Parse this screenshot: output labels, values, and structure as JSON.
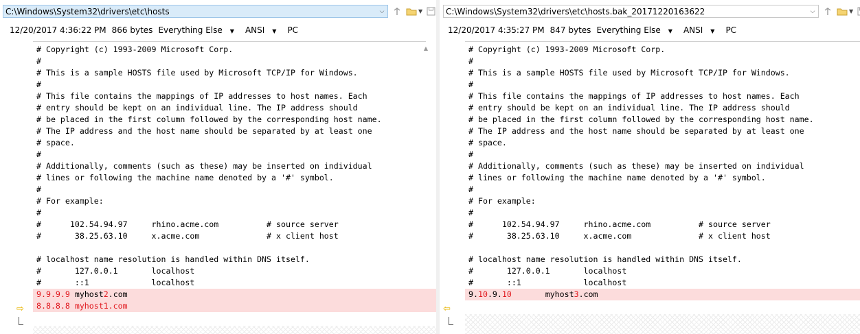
{
  "left": {
    "path": "C:\\Windows\\System32\\drivers\\etc\\hosts",
    "info": {
      "datetime": "12/20/2017 4:36:22 PM",
      "size": "866 bytes",
      "filter": "Everything Else",
      "encoding": "ANSI",
      "line_ending": "PC"
    },
    "lines": [
      "# Copyright (c) 1993-2009 Microsoft Corp.",
      "#",
      "# This is a sample HOSTS file used by Microsoft TCP/IP for Windows.",
      "#",
      "# This file contains the mappings of IP addresses to host names. Each",
      "# entry should be kept on an individual line. The IP address should",
      "# be placed in the first column followed by the corresponding host name.",
      "# The IP address and the host name should be separated by at least one",
      "# space.",
      "#",
      "# Additionally, comments (such as these) may be inserted on individual",
      "# lines or following the machine name denoted by a '#' symbol.",
      "#",
      "# For example:",
      "#",
      "#      102.54.94.97     rhino.acme.com          # source server",
      "#       38.25.63.10     x.acme.com              # x client host",
      "",
      "# localhost name resolution is handled within DNS itself.",
      "#       127.0.0.1       localhost",
      "#       ::1             localhost"
    ],
    "diff1": {
      "a": "9.9.9.9",
      "b": " myhost",
      "c": "2",
      "d": ".com"
    },
    "diff2": "8.8.8.8 myhost1.com"
  },
  "right": {
    "path": "C:\\Windows\\System32\\drivers\\etc\\hosts.bak_20171220163622",
    "info": {
      "datetime": "12/20/2017 4:35:27 PM",
      "size": "847 bytes",
      "filter": "Everything Else",
      "encoding": "ANSI",
      "line_ending": "PC"
    },
    "lines": [
      "# Copyright (c) 1993-2009 Microsoft Corp.",
      "#",
      "# This is a sample HOSTS file used by Microsoft TCP/IP for Windows.",
      "#",
      "# This file contains the mappings of IP addresses to host names. Each",
      "# entry should be kept on an individual line. The IP address should",
      "# be placed in the first column followed by the corresponding host name.",
      "# The IP address and the host name should be separated by at least one",
      "# space.",
      "#",
      "# Additionally, comments (such as these) may be inserted on individual",
      "# lines or following the machine name denoted by a '#' symbol.",
      "#",
      "# For example:",
      "#",
      "#      102.54.94.97     rhino.acme.com          # source server",
      "#       38.25.63.10     x.acme.com              # x client host",
      "",
      "# localhost name resolution is handled within DNS itself.",
      "#       127.0.0.1       localhost",
      "#       ::1             localhost"
    ],
    "diff1": {
      "a": "9.",
      "b": "10",
      "c": ".9.",
      "d": "10",
      "e": "       myhost",
      "f": "3",
      "g": ".com"
    }
  },
  "colors": {
    "diff_bg": "#fcdcdc",
    "diff_text": "#e0161c",
    "path_active_bg": "#d9ebf9"
  }
}
